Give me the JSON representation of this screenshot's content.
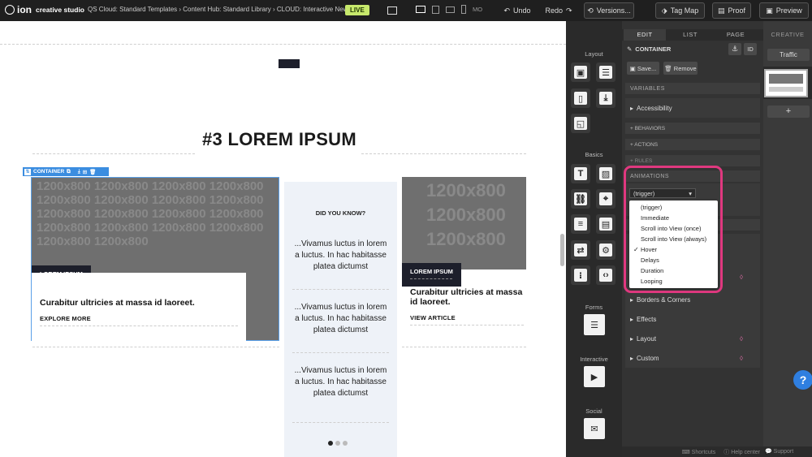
{
  "topbar": {
    "logo": "ion",
    "product": "creative studio",
    "breadcrumb": "QS Cloud: Standard Templates › Content Hub: Standard Library › CLOUD: Interactive Newsletter",
    "live_badge": "LIVE",
    "device_mode": "MO",
    "undo_label": "Undo",
    "redo_label": "Redo",
    "versions_label": "Versions...",
    "tagmap_label": "Tag Map",
    "proof_label": "Proof",
    "preview_label": "Preview"
  },
  "canvas": {
    "heading": "#3 LOREM IPSUM",
    "container_label": "CONTAINER",
    "placeholder_text": "1200x800",
    "article1": {
      "tag": "LOREM IPSUM",
      "title": "Curabitur ultricies at massa id laoreet.",
      "link": "EXPLORE MORE"
    },
    "did_you_know": {
      "title": "DID YOU KNOW?",
      "items": [
        "...Vivamus luctus in lorem a luctus. In hac habitasse platea dictumst",
        "...Vivamus luctus in lorem a luctus. In hac habitasse platea dictumst",
        "...Vivamus luctus in lorem a luctus. In hac habitasse platea dictumst"
      ]
    },
    "article2": {
      "tag": "LOREM IPSUM",
      "title": "Curabitur ultricies at massa id laoreet.",
      "link": "VIEW ARTICLE"
    }
  },
  "tools": {
    "layout_label": "Layout",
    "basics_label": "Basics",
    "forms_label": "Forms",
    "interactive_label": "Interactive",
    "social_label": "Social"
  },
  "panel": {
    "tabs": [
      "EDIT",
      "LIST",
      "PAGE"
    ],
    "element_title": "CONTAINER",
    "id_label": "ID",
    "save_label": "Save...",
    "remove_label": "Remove",
    "variables_label": "VARIABLES",
    "accessibility_label": "Accessibility",
    "behaviors_label": "+ BEHAVIORS",
    "actions_label": "+ ACTIONS",
    "rules_label": "+ RULES",
    "animations_label": "ANIMATIONS",
    "trigger_value": "(trigger)",
    "dropdown_options": [
      "(trigger)",
      "Immediate",
      "Scroll into View (once)",
      "Scroll into View (always)",
      "Hover",
      "Delays",
      "Duration",
      "Looping"
    ],
    "dropdown_checked": "Hover",
    "style_sections": [
      "Borders & Corners",
      "Effects",
      "Layout",
      "Custom"
    ],
    "footer": [
      "Shortcuts",
      "Help center",
      "Support"
    ]
  },
  "right_side": {
    "creative_label": "CREATIVE",
    "traffic_label": "Traffic",
    "add_label": "+",
    "help_label": "?"
  },
  "colors": {
    "highlight": "#e0387f",
    "live": "#c7e96c",
    "selection": "#3b8de0",
    "help": "#2f7fe0",
    "dark_tag": "#1d1f2b"
  }
}
